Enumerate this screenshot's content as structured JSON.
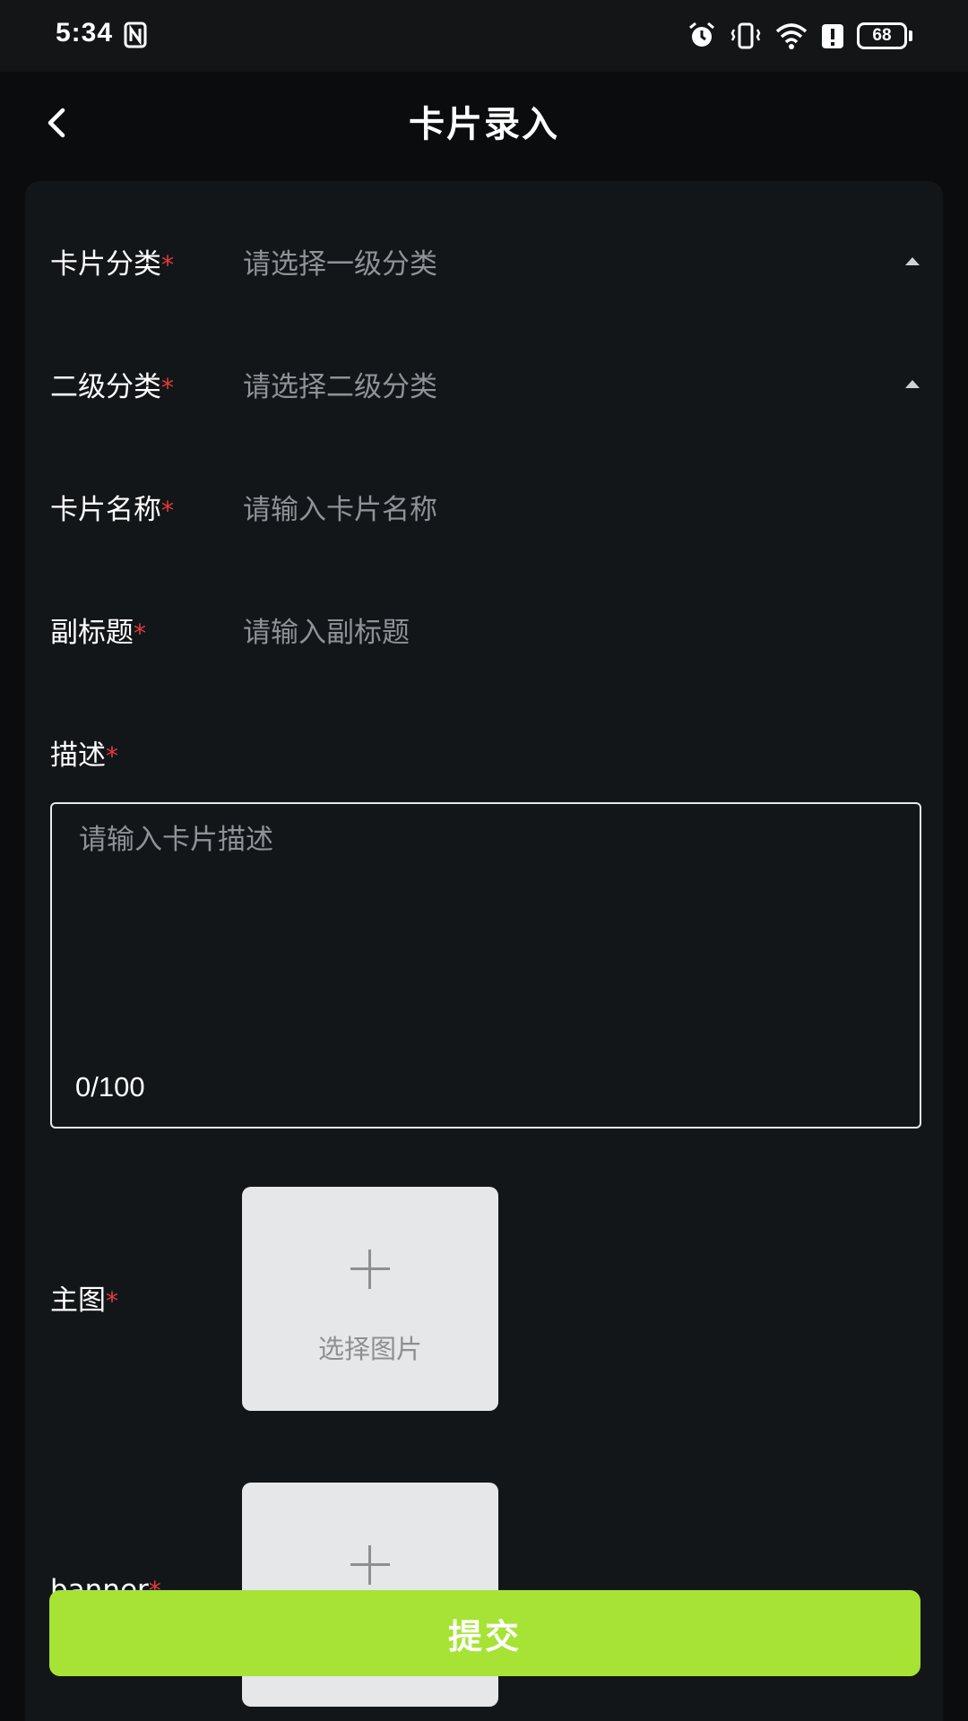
{
  "status_bar": {
    "time": "5:34",
    "battery": "68"
  },
  "header": {
    "title": "卡片录入"
  },
  "form": {
    "category": {
      "label": "卡片分类",
      "required": "*",
      "placeholder": "请选择一级分类"
    },
    "subcategory": {
      "label": "二级分类",
      "required": "*",
      "placeholder": "请选择二级分类"
    },
    "card_name": {
      "label": "卡片名称",
      "required": "*",
      "placeholder": "请输入卡片名称"
    },
    "subtitle": {
      "label": "副标题",
      "required": "*",
      "placeholder": "请输入副标题"
    },
    "description": {
      "label": "描述",
      "required": "*",
      "placeholder": "请输入卡片描述",
      "counter": "0/100"
    },
    "main_image": {
      "label": "主图",
      "required": "*",
      "upload_text": "选择图片"
    },
    "banner": {
      "label": "banner",
      "required": "*"
    }
  },
  "submit": {
    "label": "提交"
  }
}
